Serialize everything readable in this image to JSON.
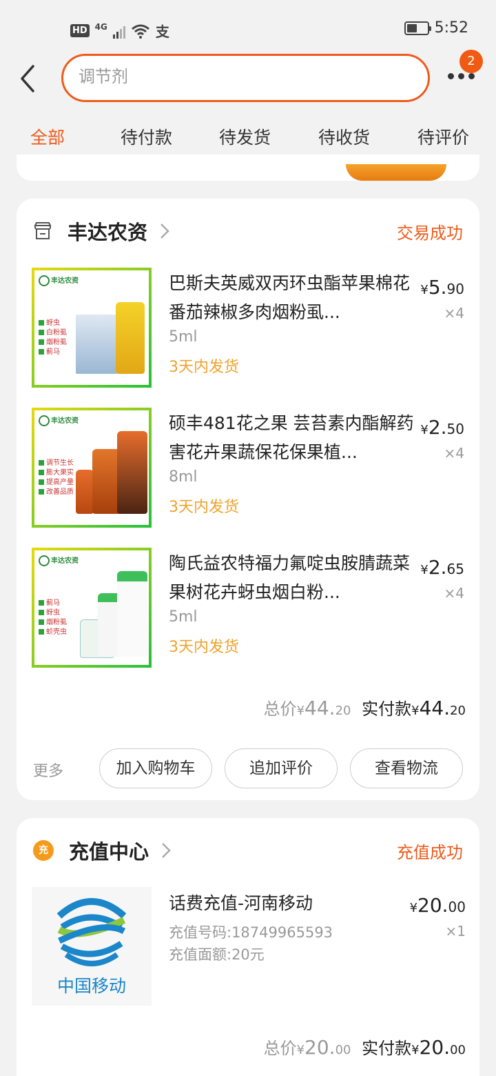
{
  "status_bar": {
    "hd": "HD",
    "network": "4G",
    "pay_glyph": "支",
    "time": "5:52"
  },
  "search": {
    "placeholder": "调节剂",
    "badge_count": "2"
  },
  "tabs": [
    {
      "label": "全部",
      "active": true
    },
    {
      "label": "待付款"
    },
    {
      "label": "待发货"
    },
    {
      "label": "待收货"
    },
    {
      "label": "待评价"
    }
  ],
  "orders": [
    {
      "shop": "丰达农资",
      "status": "交易成功",
      "items": [
        {
          "title": "巴斯夫英威双丙环虫酯苹果棉花番茄辣椒多肉烟粉虱...",
          "spec": "5ml",
          "ship": "3天内发货",
          "price_symbol": "¥",
          "price_int": "5.",
          "price_dec": "90",
          "qty": "×4",
          "thumb_logo": "丰达农资",
          "thumb_bullets": [
            "蚜虫",
            "白粉虱",
            "烟粉虱",
            "蓟马"
          ]
        },
        {
          "title": "硕丰481花之果 芸苔素内酯解药害花卉果蔬保花保果植...",
          "spec": "8ml",
          "ship": "3天内发货",
          "price_symbol": "¥",
          "price_int": "2.",
          "price_dec": "50",
          "qty": "×4",
          "thumb_logo": "丰达农资",
          "thumb_bullets": [
            "调节生长",
            "膨大果实",
            "提高产量",
            "改善品质"
          ]
        },
        {
          "title": "陶氏益农特福力氟啶虫胺腈蔬菜果树花卉蚜虫烟白粉...",
          "spec": "5ml",
          "ship": "3天内发货",
          "price_symbol": "¥",
          "price_int": "2.",
          "price_dec": "65",
          "qty": "×4",
          "thumb_logo": "丰达农资",
          "thumb_bullets": [
            "蓟马",
            "蚜虫",
            "烟粉虱",
            "蚧壳虫"
          ]
        }
      ],
      "total_label": "总价",
      "total_symbol": "¥",
      "total_int": "44.",
      "total_dec": "20",
      "paid_label": "实付款",
      "paid_symbol": "¥",
      "paid_int": "44.",
      "paid_dec": "20",
      "more_label": "更多",
      "buttons": [
        "加入购物车",
        "追加评价",
        "查看物流"
      ]
    },
    {
      "shop": "充值中心",
      "shop_icon_glyph": "充",
      "status": "充值成功",
      "item": {
        "title": "话费充值-河南移动",
        "line1": "充值号码:18749965593",
        "line2": "充值面额:20元",
        "price_symbol": "¥",
        "price_int": "20.",
        "price_dec": "00",
        "qty": "×1",
        "logo_text": "中国移动"
      },
      "total_label": "总价",
      "total_symbol": "¥",
      "total_int": "20.",
      "total_dec": "00",
      "paid_label": "实付款",
      "paid_symbol": "¥",
      "paid_int": "20.",
      "paid_dec": "00"
    }
  ],
  "colors": {
    "accent": "#ef5a1a",
    "ship_text": "#f0a22b",
    "cm_blue": "#1b86c9"
  }
}
